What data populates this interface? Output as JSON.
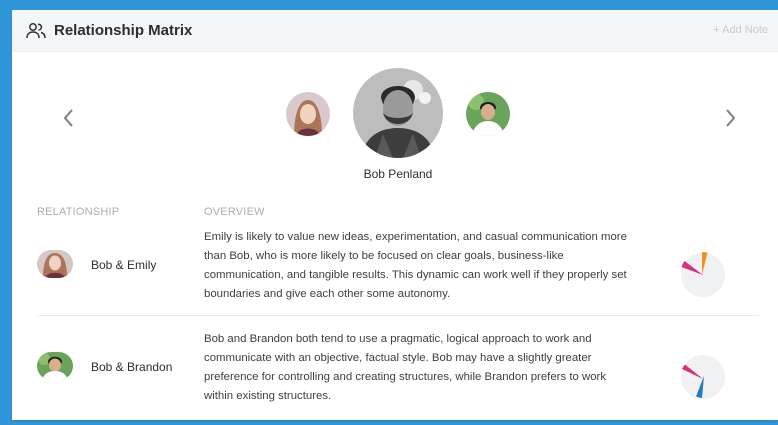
{
  "header": {
    "title": "Relationship Matrix",
    "add_note": "+ Add Note",
    "icon": "people-icon"
  },
  "carousel": {
    "focus_name": "Bob Penland",
    "left_arrow_icon": "chevron-left-icon",
    "right_arrow_icon": "chevron-right-icon"
  },
  "table": {
    "headers": {
      "relationship": "RELATIONSHIP",
      "overview": "OVERVIEW"
    },
    "rows": [
      {
        "name": "Bob & Emily",
        "overview": "Emily is likely to value new ideas, experimentation, and casual communication more than Bob, who is more likely to be focused on clear goals, business-like communication, and tangible results. This dynamic can work well if they properly set boundaries and give each other some autonomy."
      },
      {
        "name": "Bob & Brandon",
        "overview": "Bob and Brandon both tend to use a pragmatic, logical approach to work and communicate with an objective, factual style. Bob may have a slightly greater preference for controlling and creating structures, while Brandon prefers to work within existing structures."
      }
    ]
  },
  "colors": {
    "background": "#2f97d9",
    "pie_base": "#f0f1f3",
    "orange": "#f5901e",
    "magenta": "#d6317e",
    "blue": "#1f7dbb"
  }
}
